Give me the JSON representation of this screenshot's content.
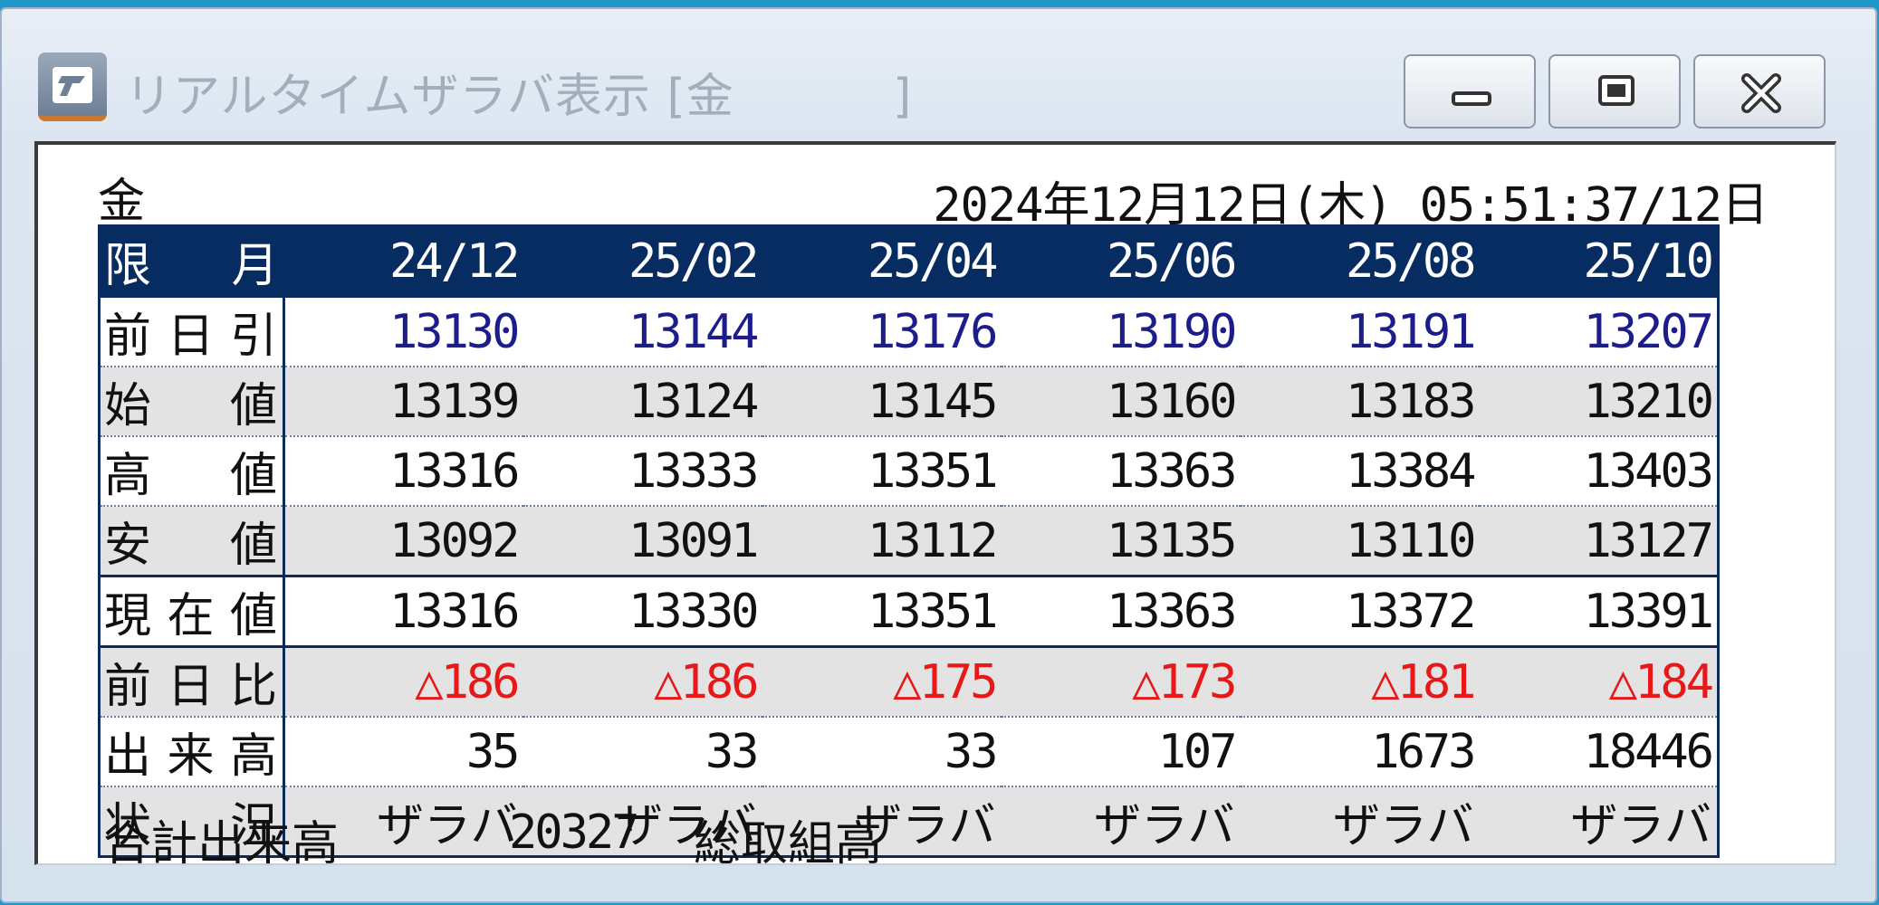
{
  "window": {
    "title": "リアルタイムザラバ表示 [金          ]",
    "app_icon": "app-logo-icon",
    "buttons": {
      "minimize": "minimize-icon",
      "maximize": "maximize-icon",
      "close": "close-icon"
    }
  },
  "header": {
    "commodity": "金",
    "timestamp": "2024年12月12日(木) 05:51:37/12日"
  },
  "table": {
    "columns": [
      "限　月",
      "24/12",
      "25/02",
      "25/04",
      "25/06",
      "25/08",
      "25/10"
    ],
    "rows": [
      {
        "label": "前日引",
        "values": [
          "13130",
          "13144",
          "13176",
          "13190",
          "13191",
          "13207"
        ]
      },
      {
        "label": "始　値",
        "values": [
          "13139",
          "13124",
          "13145",
          "13160",
          "13183",
          "13210"
        ]
      },
      {
        "label": "高　値",
        "values": [
          "13316",
          "13333",
          "13351",
          "13363",
          "13384",
          "13403"
        ]
      },
      {
        "label": "安　値",
        "values": [
          "13092",
          "13091",
          "13112",
          "13135",
          "13110",
          "13127"
        ]
      },
      {
        "label": "現在値",
        "values": [
          "13316",
          "13330",
          "13351",
          "13363",
          "13372",
          "13391"
        ]
      },
      {
        "label": "前日比",
        "values": [
          "△186",
          "△186",
          "△175",
          "△173",
          "△181",
          "△184"
        ]
      },
      {
        "label": "出来高",
        "values": [
          "35",
          "33",
          "33",
          "107",
          "1673",
          "18446"
        ]
      },
      {
        "label": "状　況",
        "values": [
          "ザラバ",
          "ザラバ",
          "ザラバ",
          "ザラバ",
          "ザラバ",
          "ザラバ"
        ]
      }
    ]
  },
  "footer": {
    "total_volume_label": "合計出来高",
    "total_volume_value": "20327",
    "open_interest_label": "総取組高"
  },
  "colors": {
    "header_bg": "#062c61",
    "prev_close_text": "#1c1c8a",
    "change_text": "#e81818",
    "alt_row_bg": "#e3e3e3"
  }
}
